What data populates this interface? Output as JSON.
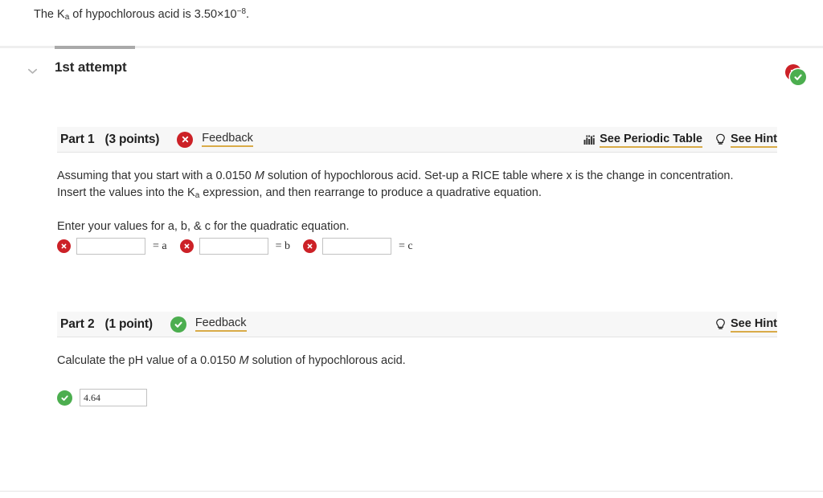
{
  "intro": {
    "text_before": "The K",
    "sub": "a",
    "text_mid": " of hypochlorous acid is 3.50×10",
    "sup": "−8",
    "text_after": "."
  },
  "attempt": {
    "title": "1st attempt",
    "collapse_icon": "chevron-down-icon",
    "status_icons": [
      "incorrect-badge-icon",
      "correct-badge-icon"
    ],
    "progress_percent": 10
  },
  "colors": {
    "incorrect_red": "#cc2127",
    "correct_green": "#4cae4f",
    "link_underline_gold": "#d9ab48",
    "header_band": "#f7f7f7"
  },
  "parts": [
    {
      "name": "Part 1",
      "points": "(3 points)",
      "status": "incorrect",
      "feedback_label": "Feedback",
      "tools": [
        {
          "icon": "periodic-table-icon",
          "label": "See Periodic Table"
        },
        {
          "icon": "lightbulb-icon",
          "label": "See Hint"
        }
      ],
      "question_line1_a": "Assuming that you start with a 0.0150 ",
      "question_line1_italic": "M",
      "question_line1_b": " solution of hypochlorous acid. Set-up a RICE table where x is the change in concentration.",
      "question_line2_a": "Insert the values into the K",
      "question_line2_sub": "a",
      "question_line2_b": " expression, and then rearrange to produce a quadrative equation.",
      "prompt": "Enter your values for a, b, & c for the quadratic equation.",
      "fields": [
        {
          "value": "",
          "status": "incorrect",
          "label": "= a"
        },
        {
          "value": "",
          "status": "incorrect",
          "label": "= b"
        },
        {
          "value": "",
          "status": "incorrect",
          "label": "= c"
        }
      ]
    },
    {
      "name": "Part 2",
      "points": "(1 point)",
      "status": "correct",
      "feedback_label": "Feedback",
      "tools": [
        {
          "icon": "lightbulb-icon",
          "label": "See Hint"
        }
      ],
      "question_a": "Calculate the pH value of a 0.0150 ",
      "question_italic": "M",
      "question_b": " solution of hypochlorous acid.",
      "answer": {
        "value": "4.64",
        "status": "correct"
      }
    }
  ]
}
